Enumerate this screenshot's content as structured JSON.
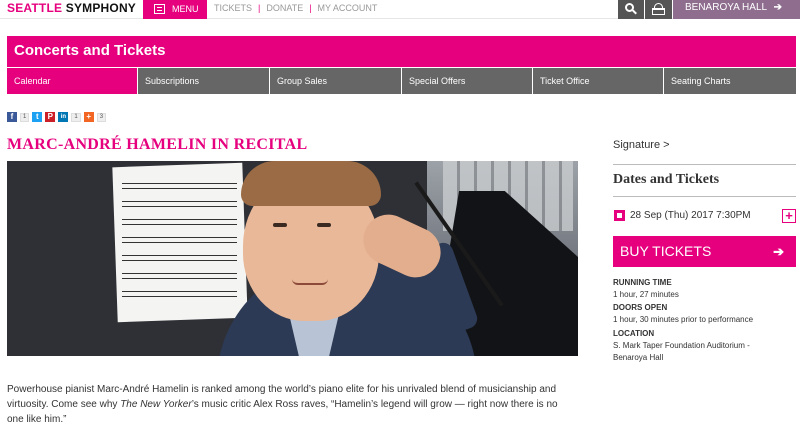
{
  "header": {
    "logo_part1": "SEATTLE",
    "logo_part2": "SYMPHONY",
    "menu_label": "MENU",
    "links": [
      "TICKETS",
      "DONATE",
      "MY ACCOUNT"
    ],
    "venue_label": "BENAROYA HALL",
    "venue_arrow": "➔"
  },
  "banner": {
    "title": "Concerts and Tickets"
  },
  "subnav": {
    "tabs": [
      {
        "label": "Calendar",
        "active": true
      },
      {
        "label": "Subscriptions"
      },
      {
        "label": "Group Sales"
      },
      {
        "label": "Special Offers"
      },
      {
        "label": "Ticket Office"
      },
      {
        "label": "Seating Charts"
      }
    ]
  },
  "share": {
    "facebook": {
      "glyph": "f",
      "count": "1",
      "color": "#3b5998"
    },
    "twitter": {
      "glyph": "t",
      "color": "#1da1f2"
    },
    "pinterest": {
      "glyph": "P",
      "color": "#cb2027"
    },
    "linkedin": {
      "glyph": "in",
      "count": "1",
      "color": "#0077b5"
    },
    "more": {
      "glyph": "+",
      "count": "3",
      "color": "#f26522"
    }
  },
  "event": {
    "title": "MARC-ANDRÉ HAMELIN IN RECITAL",
    "description_1": "Powerhouse pianist Marc-André Hamelin is ranked among the world’s piano elite for his unrivaled blend of musicianship and virtuosity. Come see why ",
    "description_em": "The New Yorker",
    "description_2": "’s music critic Alex Ross raves, “Hamelin’s legend will grow — right now there is no one like him.”"
  },
  "sidebar": {
    "series_link": "Signature >",
    "dates_title": "Dates and Tickets",
    "date": "28 Sep (Thu) 2017 7:30PM",
    "plus": "+",
    "buy_label": "BUY TICKETS",
    "buy_arrow": "➔",
    "running_time_label": "RUNNING TIME",
    "running_time": "1 hour, 27 minutes",
    "doors_label": "DOORS OPEN",
    "doors": "1 hour, 30 minutes prior to performance",
    "location_label": "LOCATION",
    "location_1": "S. Mark Taper Foundation Auditorium -",
    "location_2": "Benaroya Hall"
  },
  "colors": {
    "brand": "#e6007e",
    "nav_gray": "#666666",
    "venue": "#8e6d8f"
  }
}
